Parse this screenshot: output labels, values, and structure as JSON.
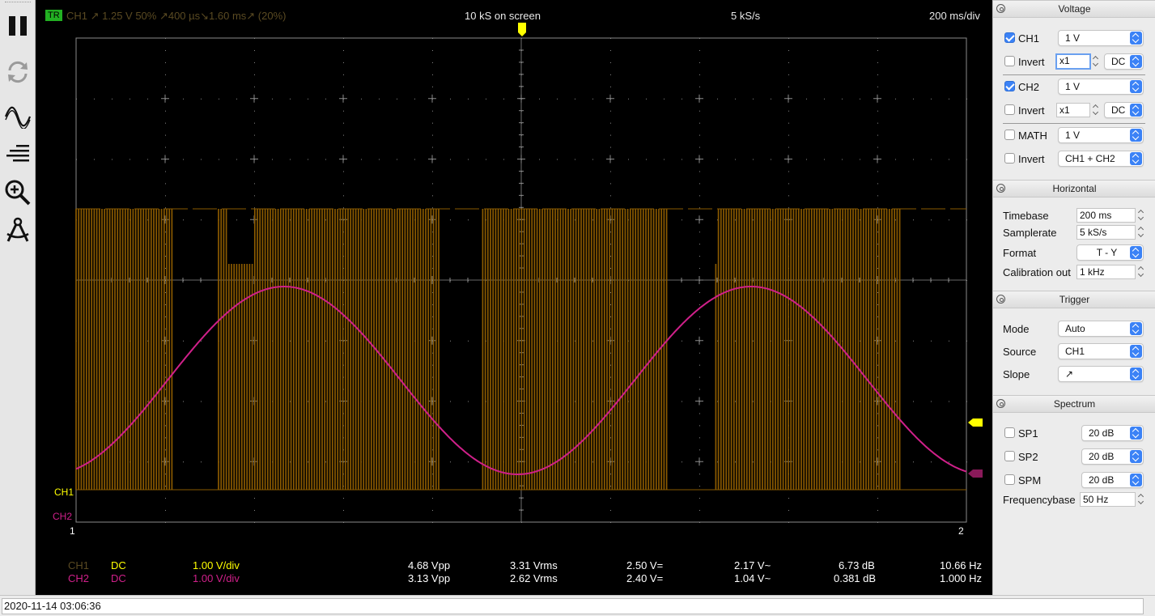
{
  "header": {
    "tr_badge": "TR",
    "trigger_info": "CH1  ↗  1.25 V  50%  ↗400 µs↘1.60 ms↗ (20%)",
    "samples_on_screen": "10 kS on screen",
    "samplerate": "5 kS/s",
    "timebase": "200 ms/div"
  },
  "markers": {
    "ch1": "CH1",
    "ch2": "CH2",
    "cursor1": "1",
    "cursor2": "2"
  },
  "colors": {
    "ch1": "#ffff00",
    "ch1_signal": "#8a5a00",
    "ch2": "#d0208a",
    "grid": "#8a8a8a",
    "accent": "#3b82f6"
  },
  "measurements": [
    {
      "channel": "CH1",
      "coupling": "DC",
      "vdiv": "1.00 V/div",
      "vpp": "4.68 Vpp",
      "vrms": "3.31 Vrms",
      "vdc": "2.50 V=",
      "vac": "2.17 V~",
      "db": "6.73 dB",
      "freq": "10.66 Hz"
    },
    {
      "channel": "CH2",
      "coupling": "DC",
      "vdiv": "1.00 V/div",
      "vpp": "3.13 Vpp",
      "vrms": "2.62 Vrms",
      "vdc": "2.40 V=",
      "vac": "1.04 V~",
      "db": "0.381 dB",
      "freq": "1.000 Hz"
    }
  ],
  "panel": {
    "voltage": {
      "title": "Voltage",
      "ch1": {
        "label": "CH1",
        "checked": true,
        "gain": "1 V",
        "invert_label": "Invert",
        "invert": false,
        "probe": "x1",
        "coupling": "DC"
      },
      "ch2": {
        "label": "CH2",
        "checked": true,
        "gain": "1 V",
        "invert_label": "Invert",
        "invert": false,
        "probe": "x1",
        "coupling": "DC"
      },
      "math": {
        "label": "MATH",
        "checked": false,
        "gain": "1 V",
        "invert_label": "Invert",
        "invert": false,
        "mode": "CH1 + CH2"
      }
    },
    "horizontal": {
      "title": "Horizontal",
      "timebase_label": "Timebase",
      "timebase": "200 ms",
      "samplerate_label": "Samplerate",
      "samplerate": "5 kS/s",
      "format_label": "Format",
      "format": "T - Y",
      "calibration_label": "Calibration out",
      "calibration": "1 kHz"
    },
    "trigger": {
      "title": "Trigger",
      "mode_label": "Mode",
      "mode": "Auto",
      "source_label": "Source",
      "source": "CH1",
      "slope_label": "Slope",
      "slope": "↗"
    },
    "spectrum": {
      "title": "Spectrum",
      "sp1_label": "SP1",
      "sp1": "20 dB",
      "sp2_label": "SP2",
      "sp2": "20 dB",
      "spm_label": "SPM",
      "spm": "20 dB",
      "freqbase_label": "Frequencybase",
      "freqbase": "50 Hz"
    }
  },
  "status": {
    "timestamp": "2020-11-14 03:06:36"
  },
  "toolbar": {
    "items": [
      {
        "name": "pause-icon"
      },
      {
        "name": "refresh-icon"
      },
      {
        "name": "waveform-icon"
      },
      {
        "name": "filter-lines-icon"
      },
      {
        "name": "zoom-icon"
      },
      {
        "name": "measure-compass-icon"
      }
    ]
  }
}
